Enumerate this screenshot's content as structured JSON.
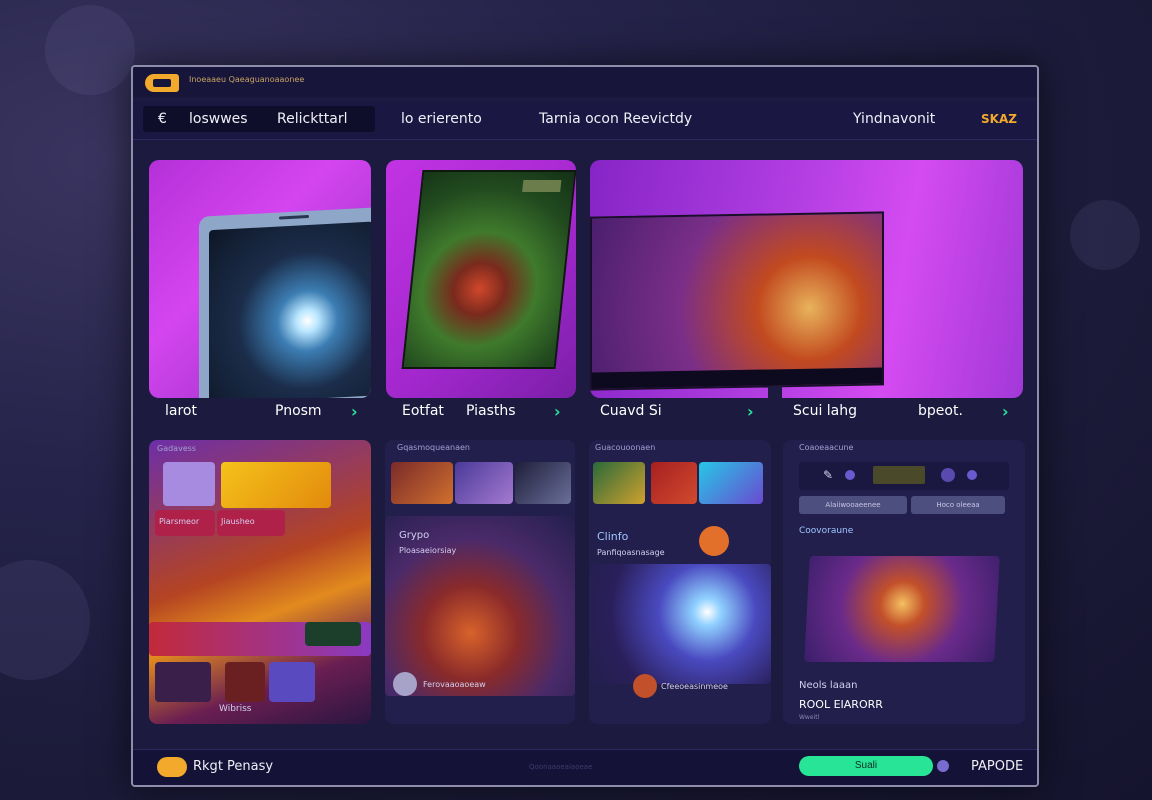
{
  "window": {
    "title": "Inoeaaeu  Qaeaguanoaaonee"
  },
  "nav": {
    "back_glyph": "€",
    "items": [
      "loswwes",
      "Relickttarl",
      "lo erierento",
      "Tarnia ocon  Reevictdy",
      "Yindnavonit"
    ],
    "accent": "SKAZ"
  },
  "cards": [
    {
      "left_label": "larot",
      "right_label": "Pnosm"
    },
    {
      "left_label": "Eotfat",
      "right_label": "Piasths"
    },
    {
      "left_label": "Cuavd Si",
      "right_label": ""
    },
    {
      "left_label": "Scui lahg",
      "right_label": "bpeot."
    }
  ],
  "panels": {
    "p1": {
      "head": "Gadavess",
      "tag1": "Piarsmeor",
      "tag2": "Jiausheo",
      "bottom": "Wibriss"
    },
    "p2": {
      "head": "Gqasmoqueanaen",
      "sub_title": "Grypo",
      "sub_text": "Ploasaeiorsiay",
      "bottom": "Ferovaaoaoeaw"
    },
    "p3": {
      "head": "Guacouoonaen",
      "title": "Clinfo",
      "text": "Panfiqoasnasage",
      "bottom": "Cfeeoeasinmeoe"
    },
    "p4": {
      "head": "Coaoeaacune",
      "tab1": "Alaiiwooaeenee",
      "tab2": "Hoco oleeaa",
      "sub_title": "Coovoraune",
      "name": "Neols laaan",
      "caption": "ROOL EIARORR",
      "small": "Wweitl"
    }
  },
  "footer": {
    "left": "Rkgt Penasy",
    "center": "Qoonaaoeaiaoeae",
    "button": "Suali",
    "right": "PAPODE"
  },
  "colors": {
    "accent": "#f3a92c",
    "green": "#27e496",
    "magenta": "#c52ee6",
    "panel": "#221f4c"
  }
}
